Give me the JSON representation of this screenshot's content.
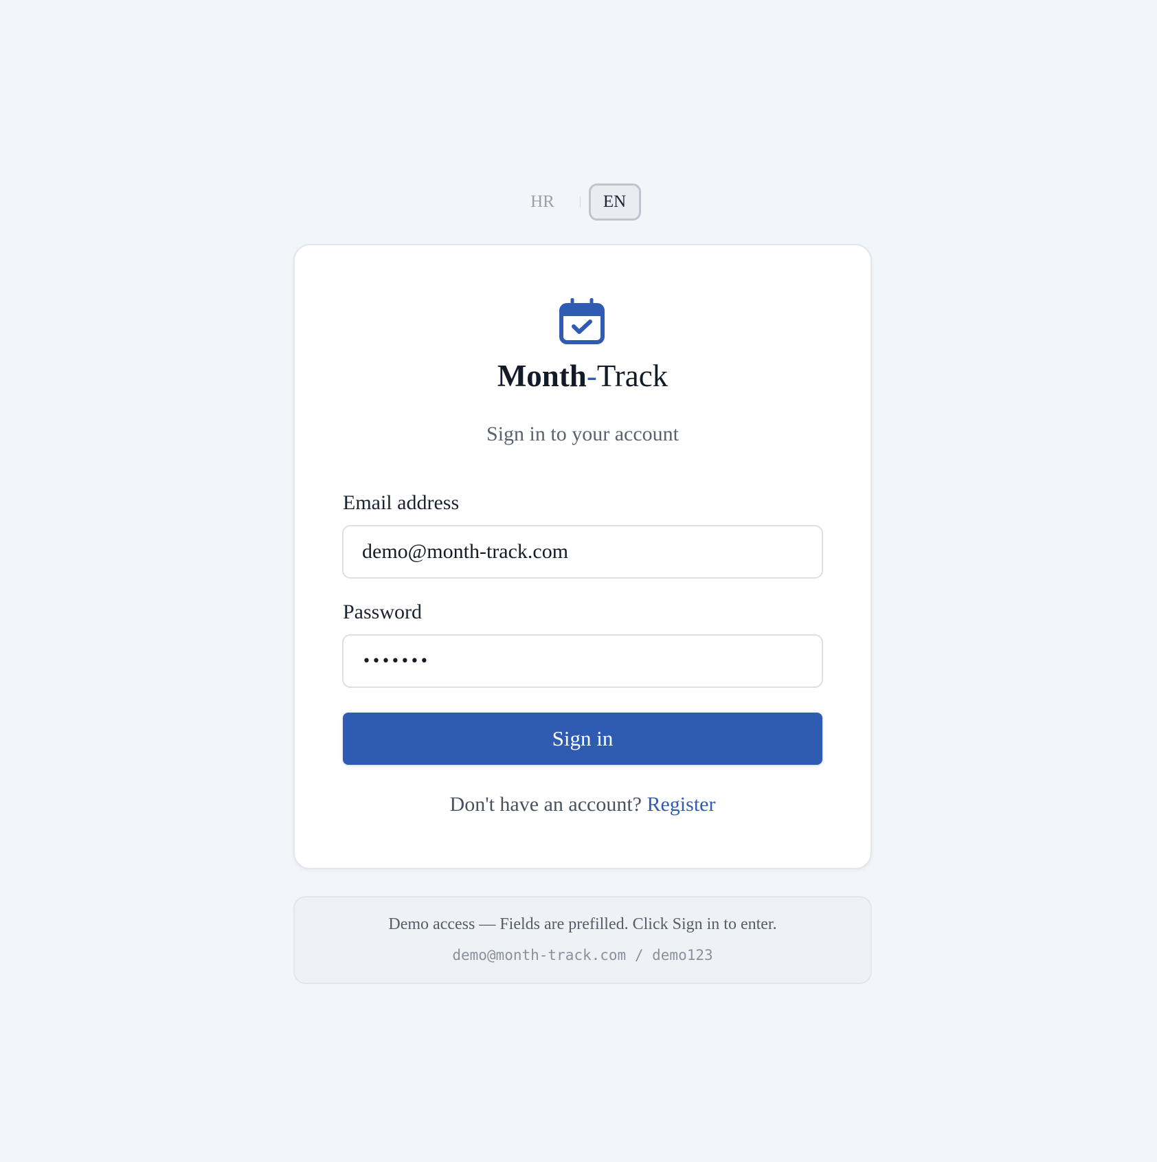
{
  "language": {
    "options": [
      "HR",
      "EN"
    ],
    "active": "EN"
  },
  "brand": {
    "part1": "Month",
    "separator": "-",
    "part2": "Track",
    "icon": "calendar-check-icon",
    "accent_color": "#2f5bb3"
  },
  "login": {
    "subtitle": "Sign in to your account",
    "email_label": "Email address",
    "email_value": "demo@month-track.com",
    "password_label": "Password",
    "password_masked": "•••••••",
    "submit_label": "Sign in",
    "no_account_text": "Don't have an account? ",
    "register_link": "Register"
  },
  "demo": {
    "text": "Demo access — Fields are prefilled. Click Sign in to enter.",
    "credentials": "demo@month-track.com / demo123"
  }
}
